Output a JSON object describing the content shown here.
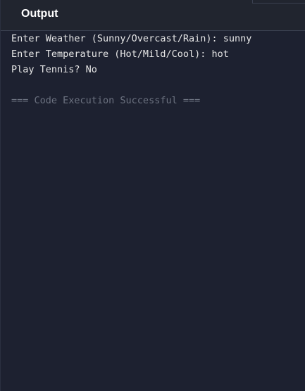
{
  "header": {
    "title": "Output"
  },
  "output": {
    "lines": [
      "Enter Weather (Sunny/Overcast/Rain): sunny",
      "Enter Temperature (Hot/Mild/Cool): hot",
      "Play Tennis? No",
      "",
      "=== Code Execution Successful ==="
    ]
  },
  "colors": {
    "background": "#1d2130",
    "header_background": "#21252f",
    "text": "#e6e6e6",
    "muted_text": "#6c7280"
  }
}
